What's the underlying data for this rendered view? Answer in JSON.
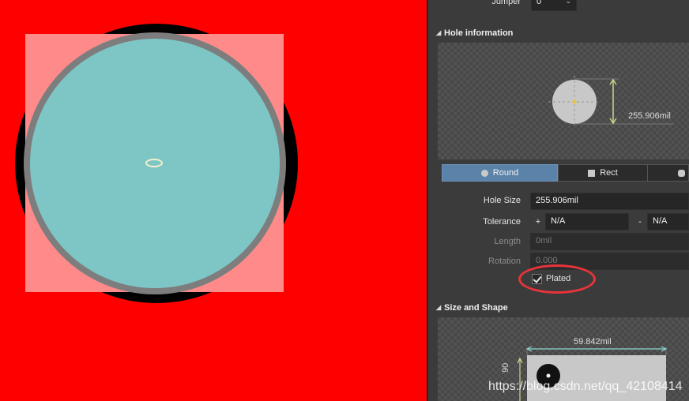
{
  "jumper": {
    "label": "Jumper",
    "value": "0"
  },
  "hole_info": {
    "title": "Hole information",
    "preview_dimension": "255.906mil",
    "shapes": [
      {
        "label": "Round",
        "icon": "round-icon",
        "active": true
      },
      {
        "label": "Rect",
        "icon": "rect-icon",
        "active": false
      },
      {
        "label": "",
        "icon": "slot-icon",
        "active": false
      }
    ],
    "hole_size": {
      "label": "Hole Size",
      "value": "255.906mil"
    },
    "tolerance": {
      "label": "Tolerance",
      "plus_sign": "+",
      "plus_value": "N/A",
      "minus_sign": "-",
      "minus_value": "N/A"
    },
    "length": {
      "label": "Length",
      "value": "0mil"
    },
    "rotation": {
      "label": "Rotation",
      "value": "0.000"
    },
    "plated": {
      "label": "Plated",
      "checked": true
    }
  },
  "size_shape": {
    "title": "Size and Shape",
    "width_dimension": "59.842mil",
    "height_dimension_partial": "90"
  },
  "watermark": "https://blog.csdn.net/qq_42108414",
  "colors": {
    "canvas_bg": "#ff0000",
    "hole_fill": "#7ec6c6",
    "pad_fill": "#ff8a8a",
    "active_button": "#5b82a8",
    "highlight": "#e8343a",
    "dimension_line": "#c5d88a",
    "dimension_line_horizontal": "#8fd6d0"
  }
}
